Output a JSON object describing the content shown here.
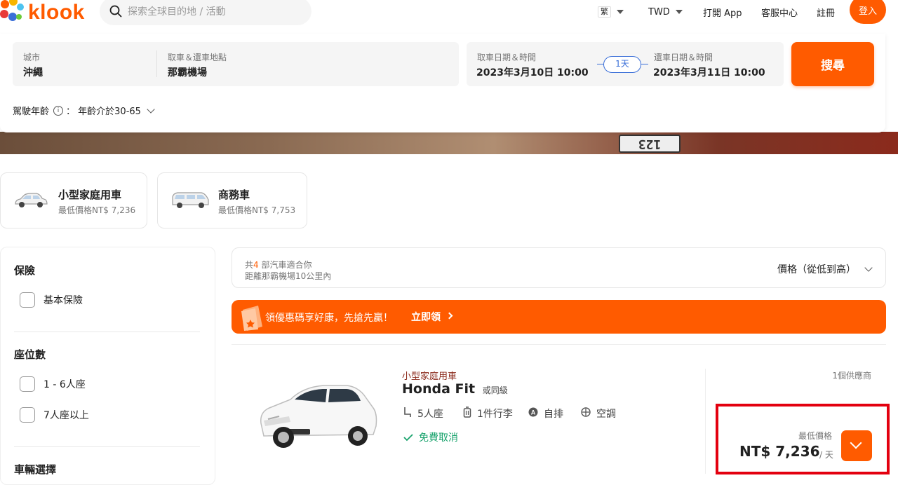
{
  "header": {
    "logo_text": "klook",
    "search_placeholder": "探索全球目的地 / 活動",
    "lang_label": "繁",
    "currency_label": "TWD",
    "open_app_label": "打開 App",
    "support_label": "客服中心",
    "register_label": "註冊",
    "login_label": "登入"
  },
  "search_form": {
    "city_label": "城市",
    "city_value": "沖繩",
    "location_label": "取車＆還車地點",
    "location_value": "那霸機場",
    "pickup_label": "取車日期＆時間",
    "pickup_value": "2023年3月10日 10:00",
    "duration_badge": "1天",
    "return_label": "還車日期＆時間",
    "return_value": "2023年3月11日 10:00",
    "search_button": "搜尋",
    "age_label": "駕駛年齡",
    "age_value": "：  年齡介於30-65"
  },
  "hero": {
    "plate_text": "123"
  },
  "categories": [
    {
      "title": "小型家庭用車",
      "subtitle": "最低價格NT$ 7,236"
    },
    {
      "title": "商務車",
      "subtitle": "最低價格NT$ 7,753"
    }
  ],
  "filters": {
    "insurance_heading": "保險",
    "insurance_options": [
      "基本保險"
    ],
    "seats_heading": "座位數",
    "seat_options": [
      "1 - 6人座",
      "7人座以上"
    ],
    "vehicle_heading": "車輛選擇"
  },
  "results": {
    "count_prefix": "共",
    "count_number": "4",
    "count_suffix": " 部汽車適合你",
    "distance_text": "距離那霸機場10公里內",
    "sort_label": "價格（從低到高）"
  },
  "promo": {
    "text": "領優惠碼享好康，先搶先贏！",
    "cta": "立即領"
  },
  "car": {
    "category": "小型家庭用車",
    "name": "Honda Fit",
    "name_suffix": "或同級",
    "seats": "5人座",
    "luggage": "1件行李",
    "transmission": "自排",
    "ac": "空調",
    "free_cancel": "免費取消",
    "supplier_count": "1個供應商",
    "price_label": "最低價格",
    "price_value": "NT$ 7,236",
    "price_unit": "/ 天"
  },
  "colors": {
    "brand": "#ff5b00",
    "badge_blue": "#3a6fd8",
    "success_green": "#16a26b",
    "highlight_red": "#e3000f"
  }
}
